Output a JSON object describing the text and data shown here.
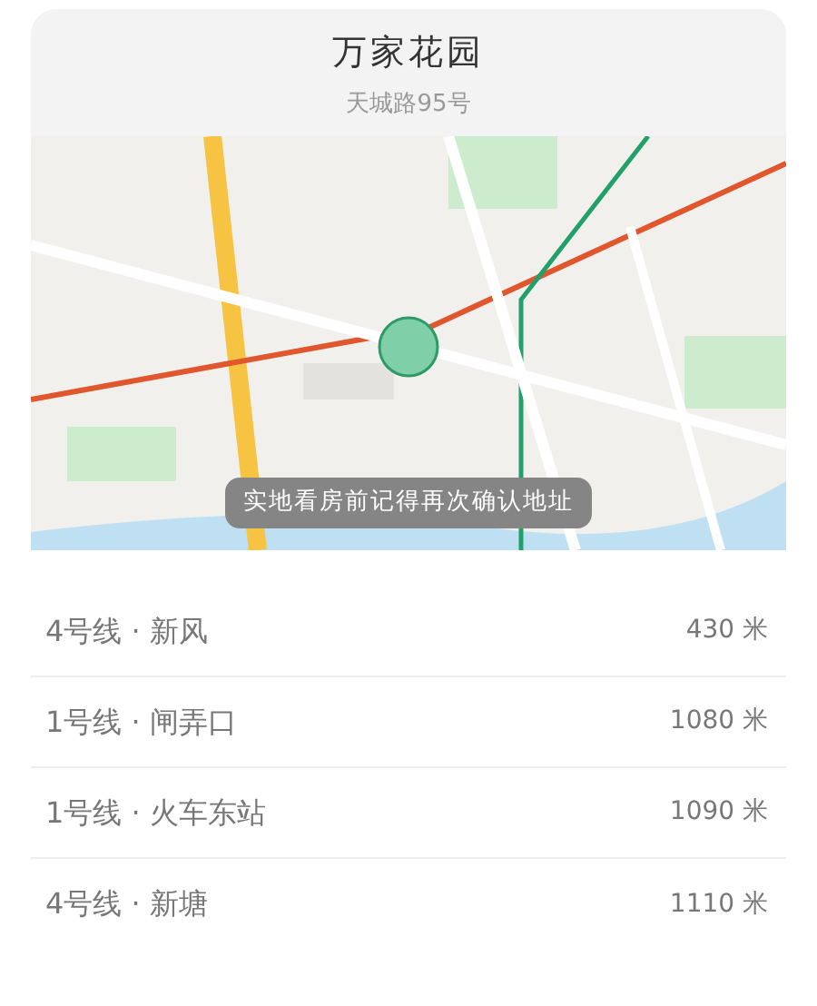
{
  "header": {
    "title": "万家花园",
    "address": "天城路95号"
  },
  "map": {
    "notice": "实地看房前记得再次确认地址"
  },
  "stations": [
    {
      "name": "4号线 · 新风",
      "distance": "430 米"
    },
    {
      "name": "1号线 · 闸弄口",
      "distance": "1080 米"
    },
    {
      "name": "1号线 · 火车东站",
      "distance": "1090 米"
    },
    {
      "name": "4号线 · 新塘",
      "distance": "1110 米"
    }
  ]
}
